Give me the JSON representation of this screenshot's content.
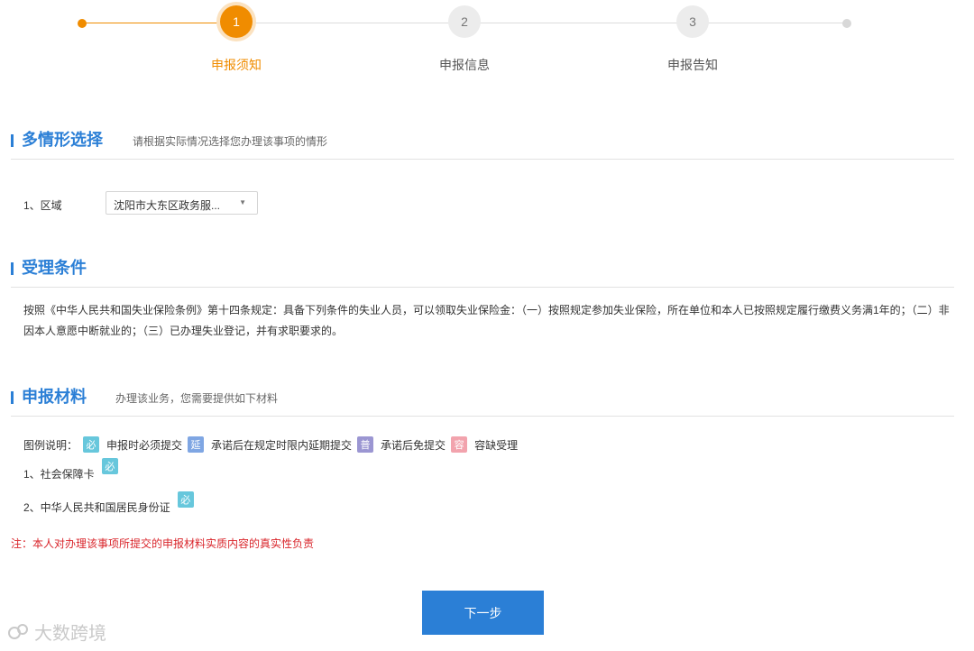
{
  "stepper": {
    "steps": [
      {
        "number": "1",
        "label": "申报须知"
      },
      {
        "number": "2",
        "label": "申报信息"
      },
      {
        "number": "3",
        "label": "申报告知"
      }
    ]
  },
  "multi_scenario": {
    "title": "多情形选择",
    "subtitle": "请根据实际情况选择您办理该事项的情形",
    "region_label": "1、区域",
    "region_value": "沈阳市大东区政务服..."
  },
  "conditions": {
    "title": "受理条件",
    "text": "按照《中华人民共和国失业保险条例》第十四条规定：具备下列条件的失业人员，可以领取失业保险金：（一）按照规定参加失业保险，所在单位和本人已按照规定履行缴费义务满1年的；（二）非因本人意愿中断就业的；（三）已办理失业登记，并有求职要求的。"
  },
  "materials": {
    "title": "申报材料",
    "subtitle": "办理该业务，您需要提供如下材料",
    "legend_label": "图例说明：",
    "legend": [
      {
        "tag": "必",
        "text": "申报时必须提交",
        "color": "#67c7dc"
      },
      {
        "tag": "延",
        "text": "承诺后在规定时限内延期提交",
        "color": "#7fa6e3"
      },
      {
        "tag": "普",
        "text": "承诺后免提交",
        "color": "#9b96d2"
      },
      {
        "tag": "容",
        "text": "容缺受理",
        "color": "#f2a3ad"
      }
    ],
    "items": [
      {
        "label": "1、社会保障卡",
        "tag": "必"
      },
      {
        "label": "2、中华人民共和国居民身份证",
        "tag": "必"
      }
    ]
  },
  "note": "注：本人对办理该事项所提交的申报材料实质内容的真实性负责",
  "next_button": "下一步",
  "watermark": "大数跨境",
  "colors": {
    "accent": "#f08c00",
    "primary": "#2b7fd6",
    "warning": "#d9252b"
  }
}
